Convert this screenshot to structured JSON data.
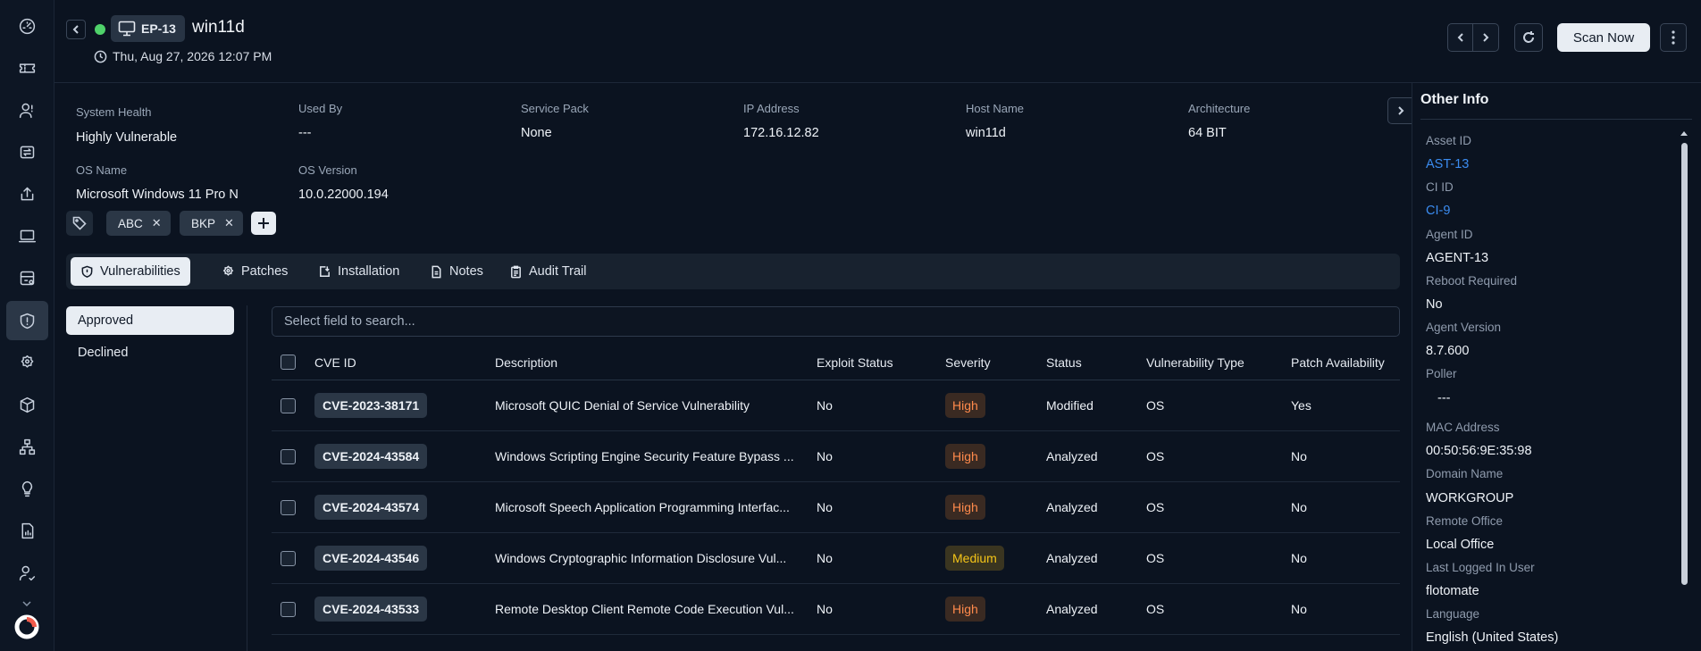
{
  "header": {
    "endpoint_id": "EP-13",
    "host_title": "win11d",
    "timestamp": "Thu, Aug 27, 2026 12:07 PM",
    "scan_button": "Scan Now"
  },
  "system_info": {
    "system_health": {
      "label": "System Health",
      "value": "Highly Vulnerable"
    },
    "used_by": {
      "label": "Used By",
      "value": "---"
    },
    "service_pack": {
      "label": "Service Pack",
      "value": "None"
    },
    "ip_address": {
      "label": "IP Address",
      "value": "172.16.12.82"
    },
    "host_name": {
      "label": "Host Name",
      "value": "win11d"
    },
    "architecture": {
      "label": "Architecture",
      "value": "64 BIT"
    },
    "os_name": {
      "label": "OS Name",
      "value": "Microsoft Windows 11 Pro N"
    },
    "os_version": {
      "label": "OS Version",
      "value": "10.0.22000.194"
    }
  },
  "tags": [
    "ABC",
    "BKP"
  ],
  "tabs": [
    {
      "label": "Vulnerabilities",
      "icon": "shield-icon",
      "active": true
    },
    {
      "label": "Patches",
      "icon": "patch-icon",
      "active": false
    },
    {
      "label": "Installation",
      "icon": "install-icon",
      "active": false
    },
    {
      "label": "Notes",
      "icon": "document-icon",
      "active": false
    },
    {
      "label": "Audit Trail",
      "icon": "clipboard-icon",
      "active": false
    }
  ],
  "filters": [
    {
      "label": "Approved",
      "active": true
    },
    {
      "label": "Declined",
      "active": false
    }
  ],
  "search": {
    "placeholder": "Select field to search..."
  },
  "table": {
    "columns": [
      "CVE ID",
      "Description",
      "Exploit Status",
      "Severity",
      "Status",
      "Vulnerability Type",
      "Patch Availability"
    ],
    "rows": [
      {
        "cve": "CVE-2023-38171",
        "description": "Microsoft QUIC Denial of Service Vulnerability",
        "exploit": "No",
        "severity": "High",
        "status": "Modified",
        "type": "OS",
        "patch": "Yes"
      },
      {
        "cve": "CVE-2024-43584",
        "description": "Windows Scripting Engine Security Feature Bypass ...",
        "exploit": "No",
        "severity": "High",
        "status": "Analyzed",
        "type": "OS",
        "patch": "No"
      },
      {
        "cve": "CVE-2024-43574",
        "description": "Microsoft Speech Application Programming Interfac...",
        "exploit": "No",
        "severity": "High",
        "status": "Analyzed",
        "type": "OS",
        "patch": "No"
      },
      {
        "cve": "CVE-2024-43546",
        "description": "Windows Cryptographic Information Disclosure Vul...",
        "exploit": "No",
        "severity": "Medium",
        "status": "Analyzed",
        "type": "OS",
        "patch": "No"
      },
      {
        "cve": "CVE-2024-43533",
        "description": "Remote Desktop Client Remote Code Execution Vul...",
        "exploit": "No",
        "severity": "High",
        "status": "Analyzed",
        "type": "OS",
        "patch": "No"
      }
    ]
  },
  "other_info": {
    "title": "Other Info",
    "fields": [
      {
        "label": "Asset ID",
        "value": "AST-13",
        "link": true
      },
      {
        "label": "CI ID",
        "value": "CI-9",
        "link": true
      },
      {
        "label": "Agent ID",
        "value": "AGENT-13",
        "link": false
      },
      {
        "label": "Reboot Required",
        "value": "No",
        "link": false
      },
      {
        "label": "Agent Version",
        "value": "8.7.600",
        "link": false
      },
      {
        "label": "Poller",
        "value": "---",
        "link": false
      },
      {
        "label": "MAC Address",
        "value": "00:50:56:9E:35:98",
        "link": false
      },
      {
        "label": "Domain Name",
        "value": "WORKGROUP",
        "link": false
      },
      {
        "label": "Remote Office",
        "value": "Local Office",
        "link": false
      },
      {
        "label": "Last Logged In User",
        "value": "flotomate",
        "link": false
      },
      {
        "label": "Language",
        "value": "English (United States)",
        "link": false
      }
    ]
  },
  "colors": {
    "background": "#0b1320",
    "accent_link": "#3b8cf0",
    "status_online": "#4fd16a",
    "severity_high": "#ff8a4c",
    "severity_medium": "#f5c518"
  }
}
